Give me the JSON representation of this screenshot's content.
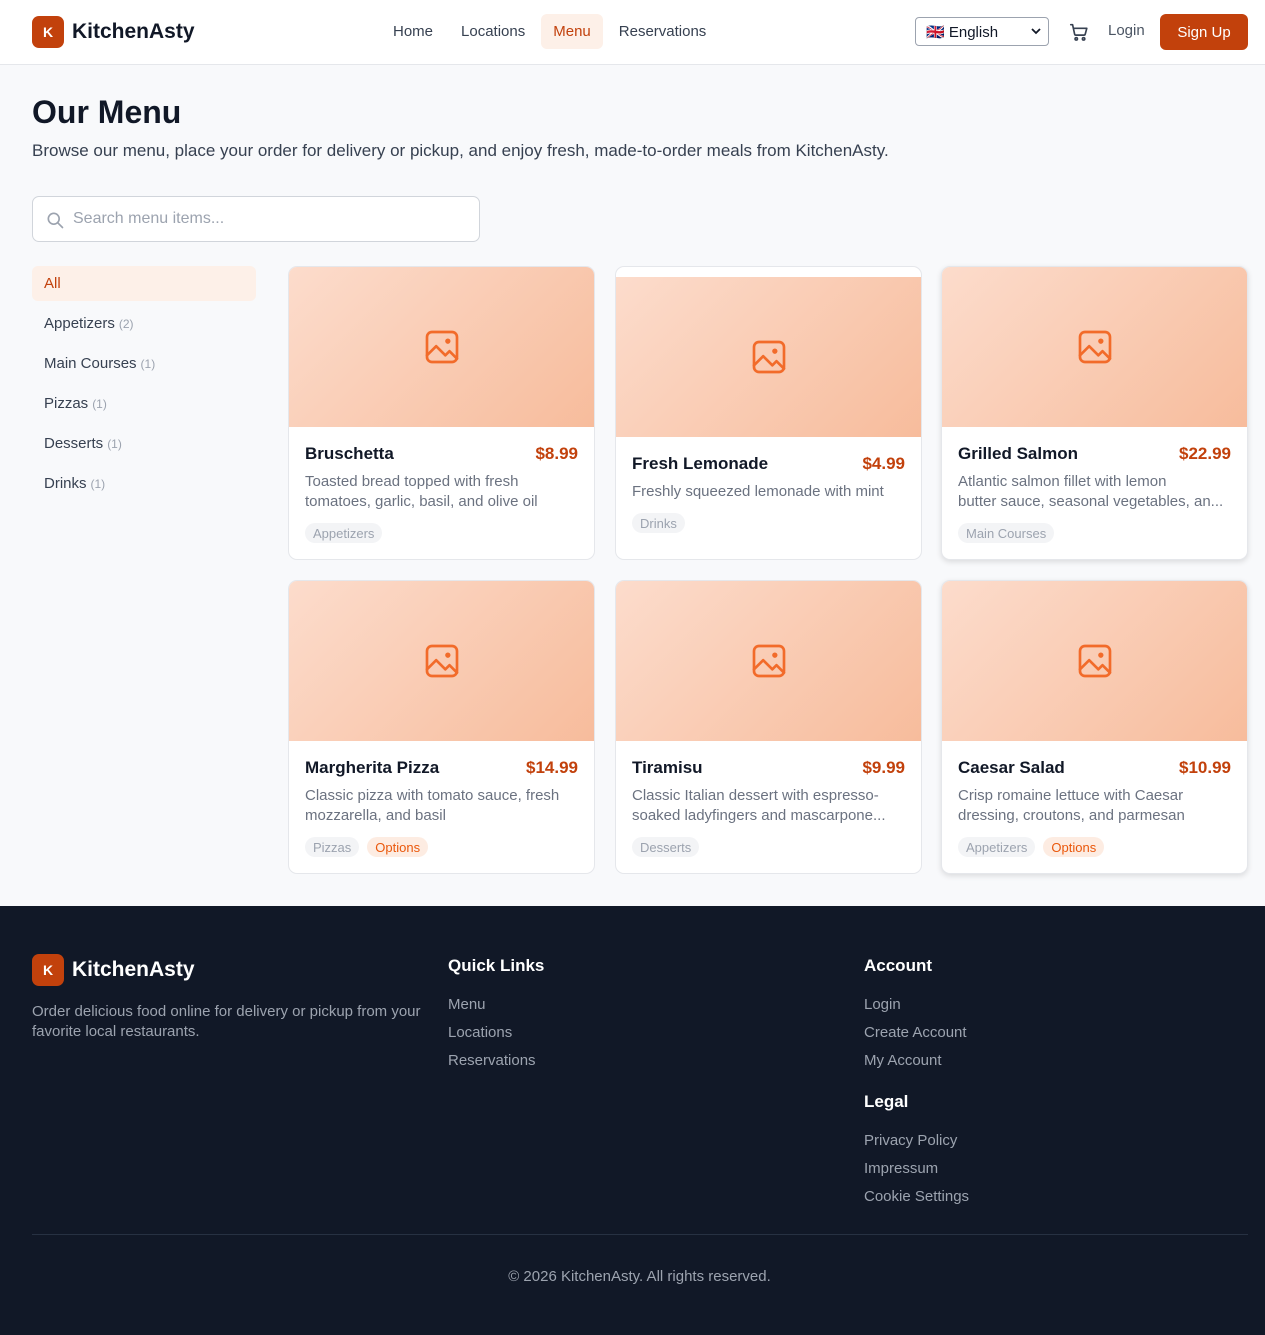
{
  "brand": {
    "logo_letter": "K",
    "name": "KitchenAsty",
    "accent": "#c2410c"
  },
  "nav": {
    "items": [
      {
        "label": "Home"
      },
      {
        "label": "Locations"
      },
      {
        "label": "Menu",
        "active": true
      },
      {
        "label": "Reservations"
      }
    ],
    "language": "🇬🇧 English",
    "login": "Login",
    "signup": "Sign Up"
  },
  "page": {
    "title": "Our Menu",
    "subtitle": "Browse our menu, place your order for delivery or pickup, and enjoy fresh, made-to-order meals from KitchenAsty."
  },
  "search": {
    "placeholder": "Search menu items...",
    "value": ""
  },
  "categories": [
    {
      "label": "All",
      "count": "",
      "active": true
    },
    {
      "label": "Appetizers",
      "count": "(2)"
    },
    {
      "label": "Main Courses",
      "count": "(1)"
    },
    {
      "label": "Pizzas",
      "count": "(1)"
    },
    {
      "label": "Desserts",
      "count": "(1)"
    },
    {
      "label": "Drinks",
      "count": "(1)"
    }
  ],
  "items": [
    {
      "name": "Bruschetta",
      "price": "$8.99",
      "desc1": "Toasted bread topped with fresh",
      "desc2": "tomatoes, garlic, basil, and olive oil",
      "tags": [
        "Appetizers"
      ]
    },
    {
      "name": "Fresh Lemonade",
      "price": "$4.99",
      "desc1": "Freshly squeezed lemonade with mint",
      "desc2": "",
      "tags": [
        "Drinks"
      ]
    },
    {
      "name": "Grilled Salmon",
      "price": "$22.99",
      "desc1": "Atlantic salmon fillet with lemon",
      "desc2": "butter sauce, seasonal vegetables, an...",
      "tags": [
        "Main Courses"
      ]
    },
    {
      "name": "Margherita Pizza",
      "price": "$14.99",
      "desc1": "Classic pizza with tomato sauce, fresh",
      "desc2": "mozzarella, and basil",
      "tags": [
        "Pizzas",
        "Options"
      ]
    },
    {
      "name": "Tiramisu",
      "price": "$9.99",
      "desc1": "Classic Italian dessert with espresso-",
      "desc2": "soaked ladyfingers and mascarpone...",
      "tags": [
        "Desserts"
      ]
    },
    {
      "name": "Caesar Salad",
      "price": "$10.99",
      "desc1": "Crisp romaine lettuce with Caesar",
      "desc2": "dressing, croutons, and parmesan",
      "tags": [
        "Appetizers",
        "Options"
      ]
    }
  ],
  "footer": {
    "about": "Order delicious food online for delivery or pickup from your favorite local restaurants.",
    "quick_links": {
      "title": "Quick Links",
      "links": [
        "Menu",
        "Locations",
        "Reservations"
      ]
    },
    "account": {
      "title": "Account",
      "links": [
        "Login",
        "Create Account",
        "My Account"
      ]
    },
    "legal": {
      "title": "Legal",
      "links": [
        "Privacy Policy",
        "Impressum",
        "Cookie Settings"
      ]
    },
    "copyright": "© 2026 KitchenAsty. All rights reserved."
  },
  "icons": [
    "search-icon",
    "cart-icon",
    "image-placeholder-icon",
    "chevron-down-icon"
  ]
}
